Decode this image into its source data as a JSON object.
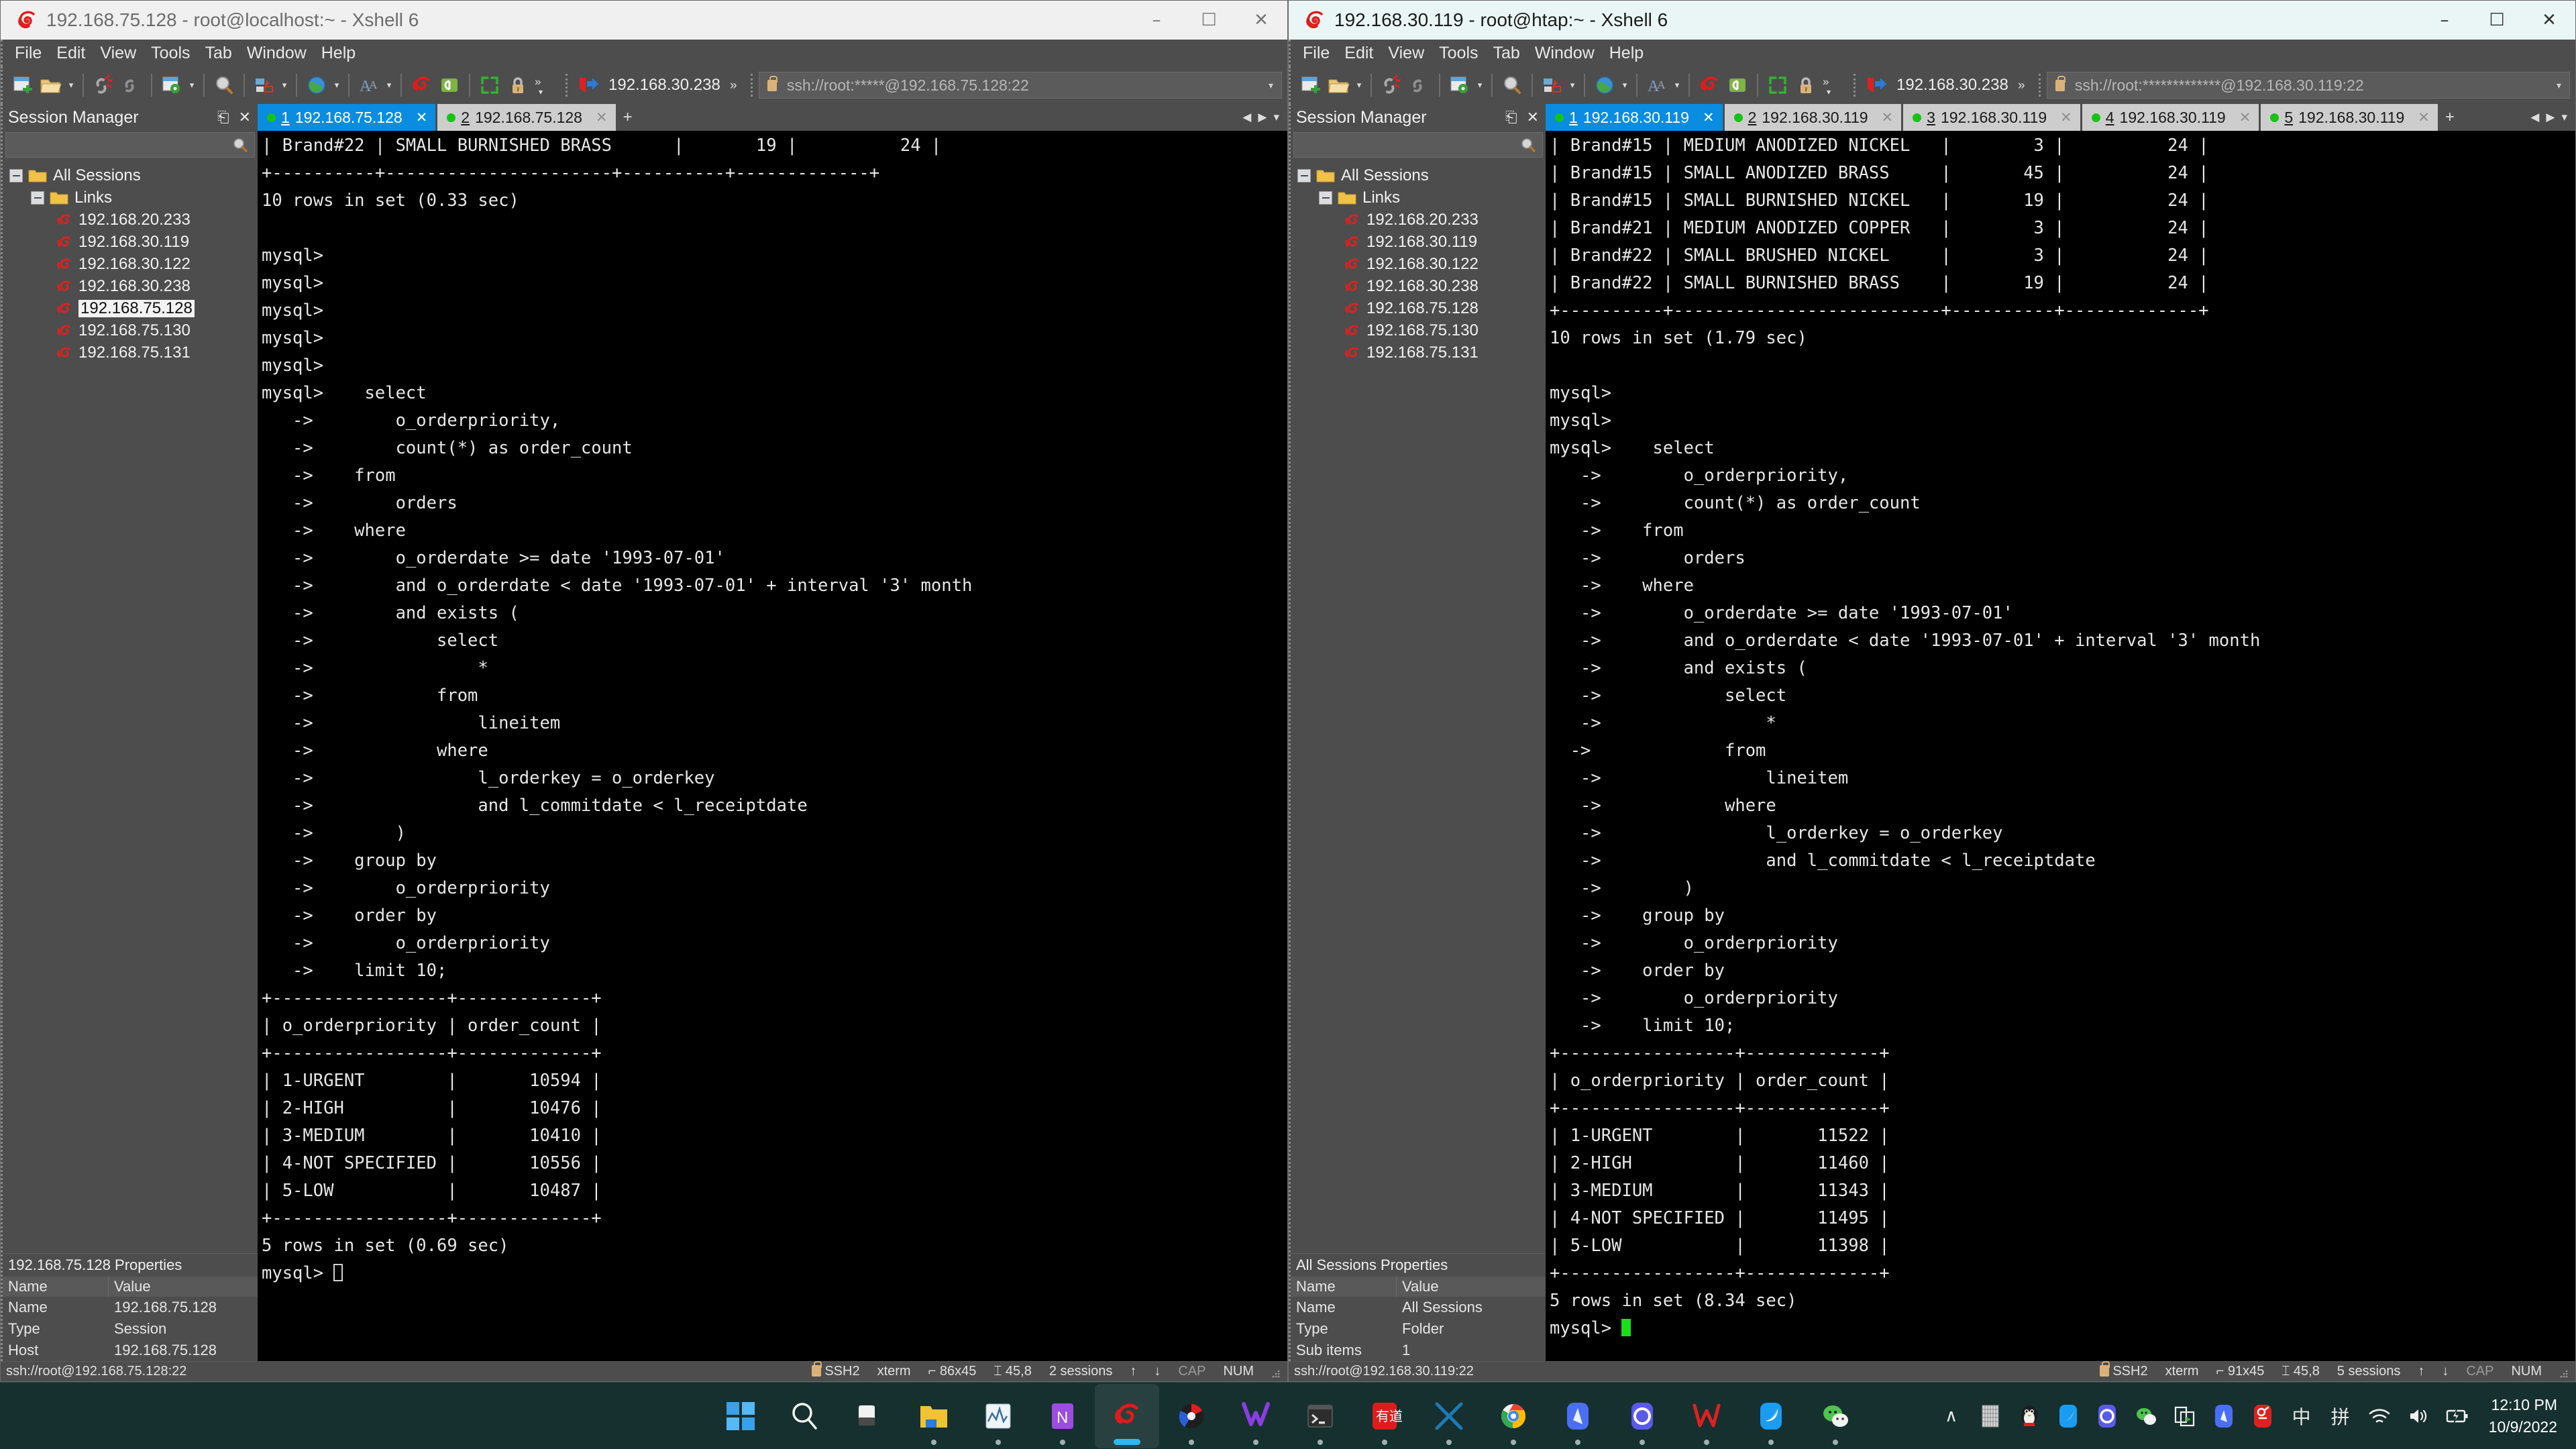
{
  "windows": [
    {
      "id": "left",
      "title": "192.168.75.128 - root@localhost:~ - Xshell 6",
      "active": false,
      "controls": {
        "minimize": "–",
        "maximize": "☐",
        "close": "✕"
      },
      "menu": [
        "File",
        "Edit",
        "View",
        "Tools",
        "Tab",
        "Window",
        "Help"
      ],
      "toolbar": {
        "chip_label": "192.168.30.238",
        "overflow": "»"
      },
      "address": {
        "value": "ssh://root:*****@192.168.75.128:22",
        "caret": "▾"
      },
      "sidebar": {
        "title": "Session Manager",
        "pin_icon": "pin-icon",
        "close_icon": "close-icon",
        "search_placeholder": "",
        "tree": [
          {
            "label": "All Sessions",
            "level": 1,
            "type": "folder",
            "expanded": true
          },
          {
            "label": "Links",
            "level": 2,
            "type": "folder",
            "expanded": true
          },
          {
            "label": "192.168.20.233",
            "level": 3,
            "type": "session",
            "selected": false
          },
          {
            "label": "192.168.30.119",
            "level": 3,
            "type": "session",
            "selected": false
          },
          {
            "label": "192.168.30.122",
            "level": 3,
            "type": "session",
            "selected": false
          },
          {
            "label": "192.168.30.238",
            "level": 3,
            "type": "session",
            "selected": false
          },
          {
            "label": "192.168.75.128",
            "level": 3,
            "type": "session",
            "selected": true
          },
          {
            "label": "192.168.75.130",
            "level": 3,
            "type": "session",
            "selected": false
          },
          {
            "label": "192.168.75.131",
            "level": 3,
            "type": "session",
            "selected": false
          }
        ],
        "properties": {
          "title": "192.168.75.128 Properties",
          "headers": [
            "Name",
            "Value"
          ],
          "rows": [
            [
              "Name",
              "192.168.75.128"
            ],
            [
              "Type",
              "Session"
            ],
            [
              "Host",
              "192.168.75.128"
            ]
          ]
        }
      },
      "tabs": [
        {
          "index": "1",
          "label": "192.168.75.128",
          "active": true,
          "close": "✕"
        },
        {
          "index": "2",
          "label": "192.168.75.128",
          "active": false,
          "close": "✕"
        }
      ],
      "tab_add": "+",
      "tab_nav": {
        "prev": "◀",
        "next": "▶",
        "menu": "▾"
      },
      "terminal": "| Brand#22 | SMALL BURNISHED BRASS      |       19 |          24 |\n+----------+----------------------+----------+-------------+\n10 rows in set (0.33 sec)\n\nmysql>\nmysql>\nmysql>\nmysql>\nmysql>\nmysql>    select\n   ->        o_orderpriority,\n   ->        count(*) as order_count\n   ->    from\n   ->        orders\n   ->    where\n   ->        o_orderdate >= date '1993-07-01'\n   ->        and o_orderdate < date '1993-07-01' + interval '3' month\n   ->        and exists (\n   ->            select\n   ->                *\n   ->            from\n   ->                lineitem\n   ->            where\n   ->                l_orderkey = o_orderkey\n   ->                and l_commitdate < l_receiptdate\n   ->        )\n   ->    group by\n   ->        o_orderpriority\n   ->    order by\n   ->        o_orderpriority\n   ->    limit 10;\n+-----------------+-------------+\n| o_orderpriority | order_count |\n+-----------------+-------------+\n| 1-URGENT        |       10594 |\n| 2-HIGH          |       10476 |\n| 3-MEDIUM        |       10410 |\n| 4-NOT SPECIFIED |       10556 |\n| 5-LOW           |       10487 |\n+-----------------+-------------+\n5 rows in set (0.69 sec)\n",
      "terminal_prompt": "mysql> ",
      "cursor_style": "hollow",
      "statusbar": {
        "left": "ssh://root@192.168.75.128:22",
        "protocol": "SSH2",
        "emulation": "xterm",
        "size": "86x45",
        "position": "45,8",
        "sessions": "2 sessions",
        "up_arrow": "↑",
        "down_arrow": "↓",
        "cap": "CAP",
        "num": "NUM"
      }
    },
    {
      "id": "right",
      "title": "192.168.30.119 - root@htap:~ - Xshell 6",
      "active": true,
      "controls": {
        "minimize": "–",
        "maximize": "☐",
        "close": "✕"
      },
      "menu": [
        "File",
        "Edit",
        "View",
        "Tools",
        "Tab",
        "Window",
        "Help"
      ],
      "toolbar": {
        "chip_label": "192.168.30.238",
        "overflow": "»"
      },
      "address": {
        "value": "ssh://root:*************@192.168.30.119:22",
        "caret": "▾"
      },
      "sidebar": {
        "title": "Session Manager",
        "pin_icon": "pin-icon",
        "close_icon": "close-icon",
        "search_placeholder": "",
        "tree": [
          {
            "label": "All Sessions",
            "level": 1,
            "type": "folder",
            "expanded": true
          },
          {
            "label": "Links",
            "level": 2,
            "type": "folder",
            "expanded": true
          },
          {
            "label": "192.168.20.233",
            "level": 3,
            "type": "session",
            "selected": false
          },
          {
            "label": "192.168.30.119",
            "level": 3,
            "type": "session",
            "selected": false
          },
          {
            "label": "192.168.30.122",
            "level": 3,
            "type": "session",
            "selected": false
          },
          {
            "label": "192.168.30.238",
            "level": 3,
            "type": "session",
            "selected": false
          },
          {
            "label": "192.168.75.128",
            "level": 3,
            "type": "session",
            "selected": false
          },
          {
            "label": "192.168.75.130",
            "level": 3,
            "type": "session",
            "selected": false
          },
          {
            "label": "192.168.75.131",
            "level": 3,
            "type": "session",
            "selected": false
          }
        ],
        "properties": {
          "title": "All Sessions Properties",
          "headers": [
            "Name",
            "Value"
          ],
          "rows": [
            [
              "Name",
              "All Sessions"
            ],
            [
              "Type",
              "Folder"
            ],
            [
              "Sub items",
              "1"
            ]
          ]
        }
      },
      "tabs": [
        {
          "index": "1",
          "label": "192.168.30.119",
          "active": true,
          "close": "✕"
        },
        {
          "index": "2",
          "label": "192.168.30.119",
          "active": false,
          "close": "✕"
        },
        {
          "index": "3",
          "label": "192.168.30.119",
          "active": false,
          "close": "✕"
        },
        {
          "index": "4",
          "label": "192.168.30.119",
          "active": false,
          "close": "✕"
        },
        {
          "index": "5",
          "label": "192.168.30.119",
          "active": false,
          "close": "✕"
        }
      ],
      "tab_add": "+",
      "tab_nav": {
        "prev": "◀",
        "next": "▶",
        "menu": "▾"
      },
      "terminal": "| Brand#15 | MEDIUM ANODIZED NICKEL   |        3 |          24 |\n| Brand#15 | SMALL ANODIZED BRASS     |       45 |          24 |\n| Brand#15 | SMALL BURNISHED NICKEL   |       19 |          24 |\n| Brand#21 | MEDIUM ANODIZED COPPER   |        3 |          24 |\n| Brand#22 | SMALL BRUSHED NICKEL     |        3 |          24 |\n| Brand#22 | SMALL BURNISHED BRASS    |       19 |          24 |\n+----------+--------------------------+----------+-------------+\n10 rows in set (1.79 sec)\n\nmysql>\nmysql>\nmysql>    select\n   ->        o_orderpriority,\n   ->        count(*) as order_count\n   ->    from\n   ->        orders\n   ->    where\n   ->        o_orderdate >= date '1993-07-01'\n   ->        and o_orderdate < date '1993-07-01' + interval '3' month\n   ->        and exists (\n   ->            select\n   ->                *\n  ->             from\n   ->                lineitem\n   ->            where\n   ->                l_orderkey = o_orderkey\n   ->                and l_commitdate < l_receiptdate\n   ->        )\n   ->    group by\n   ->        o_orderpriority\n   ->    order by\n   ->        o_orderpriority\n   ->    limit 10;\n+-----------------+-------------+\n| o_orderpriority | order_count |\n+-----------------+-------------+\n| 1-URGENT        |       11522 |\n| 2-HIGH          |       11460 |\n| 3-MEDIUM        |       11343 |\n| 4-NOT SPECIFIED |       11495 |\n| 5-LOW           |       11398 |\n+-----------------+-------------+\n5 rows in set (8.34 sec)\n",
      "terminal_prompt": "mysql> ",
      "cursor_style": "solid",
      "statusbar": {
        "left": "ssh://root@192.168.30.119:22",
        "protocol": "SSH2",
        "emulation": "xterm",
        "size": "91x45",
        "position": "45,8",
        "sessions": "5 sessions",
        "up_arrow": "↑",
        "down_arrow": "↓",
        "cap": "CAP",
        "num": "NUM"
      }
    }
  ],
  "taskbar": {
    "items": [
      {
        "name": "start-button",
        "icon": "windows-logo-icon"
      },
      {
        "name": "search-button",
        "icon": "search-icon"
      },
      {
        "name": "task-view-button",
        "icon": "task-view-icon"
      },
      {
        "name": "file-explorer-button",
        "icon": "folder-icon",
        "running": true
      },
      {
        "name": "performance-monitor-button",
        "icon": "chart-icon",
        "running": true
      },
      {
        "name": "onenote-button",
        "icon": "onenote-icon",
        "running": true
      },
      {
        "name": "xshell-button",
        "icon": "xshell-icon",
        "running": true,
        "active": true
      },
      {
        "name": "xftp-button",
        "icon": "xftp-icon",
        "running": true
      },
      {
        "name": "vmware-button",
        "icon": "vmware-icon",
        "running": true
      },
      {
        "name": "terminal-button",
        "icon": "terminal-icon",
        "running": true
      },
      {
        "name": "youdao-button",
        "icon": "youdao-icon",
        "running": true
      },
      {
        "name": "navicat-button",
        "icon": "navicat-icon",
        "running": true
      },
      {
        "name": "chrome-button",
        "icon": "chrome-icon",
        "running": true
      },
      {
        "name": "edge-button",
        "icon": "edge-icon",
        "running": true
      },
      {
        "name": "ring-app-button",
        "icon": "ring-icon",
        "running": true
      },
      {
        "name": "wps-button",
        "icon": "wps-icon",
        "running": true
      },
      {
        "name": "feishu-button",
        "icon": "feishu-icon",
        "running": true
      },
      {
        "name": "wechat-button",
        "icon": "wechat-icon",
        "running": true
      }
    ],
    "tray": [
      {
        "name": "tray-overflow-button",
        "icon": "chevron-up-icon",
        "glyph": "∧"
      },
      {
        "name": "tray-keyboard-icon",
        "icon": "keyboard-icon"
      },
      {
        "name": "tray-qq-icon",
        "icon": "qq-penguin-icon"
      },
      {
        "name": "tray-feishu-icon",
        "icon": "feishu-icon"
      },
      {
        "name": "tray-ring-icon",
        "icon": "ring-icon"
      },
      {
        "name": "tray-wechat-icon",
        "icon": "wechat-icon"
      },
      {
        "name": "tray-screenshot-icon",
        "icon": "screen-capture-icon"
      },
      {
        "name": "tray-wps-icon",
        "icon": "wps-icon"
      },
      {
        "name": "tray-maps-icon",
        "icon": "location-icon"
      },
      {
        "name": "tray-ime-mode",
        "icon": "ime-chinese-icon",
        "glyph": "中"
      },
      {
        "name": "tray-ime-pinyin",
        "icon": "ime-pinyin-icon",
        "glyph": "拼"
      },
      {
        "name": "tray-wifi-icon",
        "icon": "wifi-icon"
      },
      {
        "name": "tray-volume-icon",
        "icon": "speaker-icon"
      },
      {
        "name": "tray-battery-icon",
        "icon": "battery-charging-icon"
      }
    ],
    "clock": {
      "time": "12:10 PM",
      "date": "10/9/2022"
    }
  }
}
